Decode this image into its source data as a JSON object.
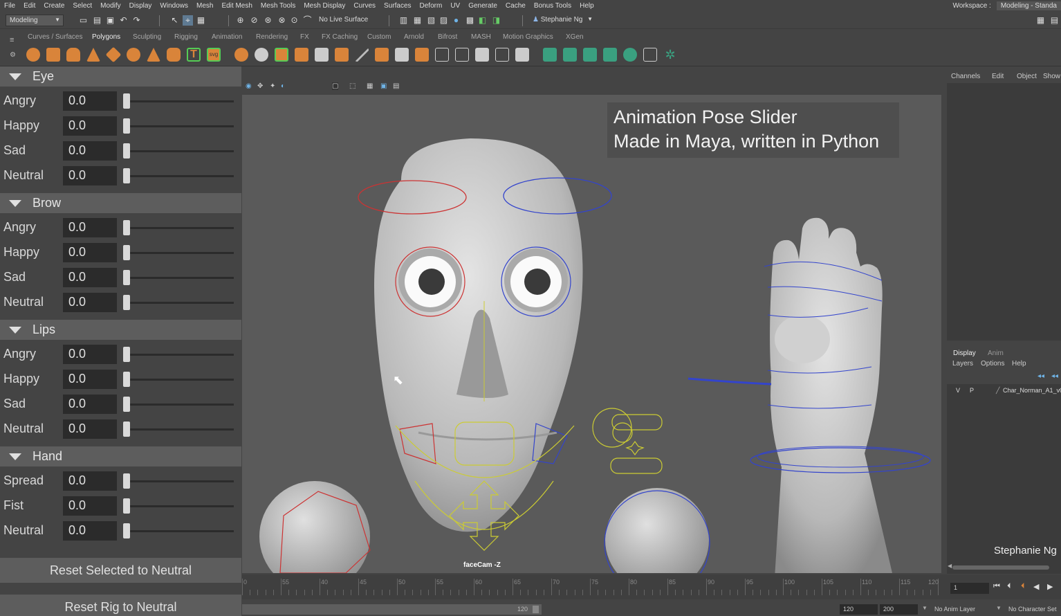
{
  "menubar": {
    "items": [
      "File",
      "Edit",
      "Create",
      "Select",
      "Modify",
      "Display",
      "Windows",
      "Mesh",
      "Edit Mesh",
      "Mesh Tools",
      "Mesh Display",
      "Curves",
      "Surfaces",
      "Deform",
      "UV",
      "Generate",
      "Cache",
      "Bonus Tools",
      "Help"
    ],
    "workspace_label": "Workspace :",
    "workspace_value": "Modeling - Standa"
  },
  "statusline": {
    "mode": "Modeling",
    "live_surface": "No Live Surface",
    "user": "Stephanie Ng"
  },
  "shelf": {
    "tabs": [
      "Curves / Surfaces",
      "Polygons",
      "Sculpting",
      "Rigging",
      "Animation",
      "Rendering",
      "FX",
      "FX Caching",
      "Custom",
      "Arnold",
      "Bifrost",
      "MASH",
      "Motion Graphics",
      "XGen"
    ],
    "active_tab": "Polygons"
  },
  "pose_panel": {
    "sections": [
      {
        "title": "Eye",
        "rows": [
          {
            "label": "Angry",
            "value": "0.0"
          },
          {
            "label": "Happy",
            "value": "0.0"
          },
          {
            "label": "Sad",
            "value": "0.0"
          },
          {
            "label": "Neutral",
            "value": "0.0"
          }
        ]
      },
      {
        "title": "Brow",
        "rows": [
          {
            "label": "Angry",
            "value": "0.0"
          },
          {
            "label": "Happy",
            "value": "0.0"
          },
          {
            "label": "Sad",
            "value": "0.0"
          },
          {
            "label": "Neutral",
            "value": "0.0"
          }
        ]
      },
      {
        "title": "Lips",
        "rows": [
          {
            "label": "Angry",
            "value": "0.0"
          },
          {
            "label": "Happy",
            "value": "0.0"
          },
          {
            "label": "Sad",
            "value": "0.0"
          },
          {
            "label": "Neutral",
            "value": "0.0"
          }
        ]
      },
      {
        "title": "Hand",
        "rows": [
          {
            "label": "Spread",
            "value": "0.0"
          },
          {
            "label": "Fist",
            "value": "0.0"
          },
          {
            "label": "Neutral",
            "value": "0.0"
          }
        ]
      }
    ],
    "reset_selected_label": "Reset Selected to Neutral",
    "reset_rig_label": "Reset Rig to Neutral"
  },
  "viewport": {
    "overlay_line1": "Animation Pose Slider",
    "overlay_line2": "Made in Maya, written in Python",
    "camera_label": "faceCam -Z"
  },
  "channel_box": {
    "tabs": [
      "Channels",
      "Edit",
      "Object",
      "Show"
    ]
  },
  "layer_editor": {
    "tabs": [
      "Display",
      "Anim"
    ],
    "active_tab": "Display",
    "menu": [
      "Layers",
      "Options",
      "Help"
    ],
    "layer": {
      "v": "V",
      "p": "P",
      "name": "Char_Norman_A1_v0"
    },
    "signature": "Stephanie Ng"
  },
  "timeline": {
    "ticks": [
      "0",
      "55",
      "40",
      "45",
      "50",
      "55",
      "60",
      "65",
      "70",
      "75",
      "80",
      "85",
      "90",
      "95",
      "100",
      "105",
      "110",
      "115",
      "120"
    ],
    "current_frame": "1"
  },
  "range": {
    "slider_end": "120",
    "end_frame": "120",
    "max_frame": "200",
    "anim_layer": "No Anim Layer",
    "char_set": "No Character Set"
  }
}
